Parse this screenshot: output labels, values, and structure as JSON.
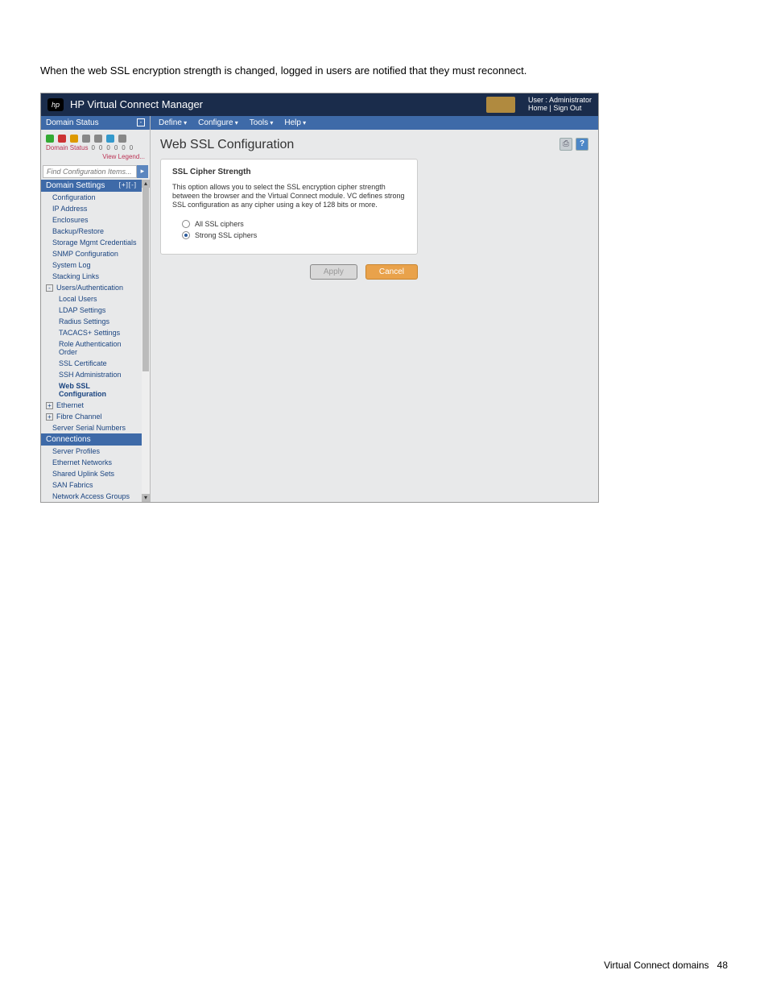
{
  "intro": "When the web SSL encryption strength is changed, logged in users are notified that they must reconnect.",
  "topbar": {
    "title": "HP Virtual Connect Manager",
    "user_label": "User : Administrator",
    "home": "Home",
    "signout": "Sign Out"
  },
  "menus": {
    "define": "Define",
    "configure": "Configure",
    "tools": "Tools",
    "help": "Help"
  },
  "domain_status": {
    "title": "Domain Status",
    "label": "Domain Status",
    "legend": "View Legend...",
    "counts": [
      "0",
      "0",
      "0",
      "0",
      "0",
      "0"
    ]
  },
  "search_placeholder": "Find Configuration Items...",
  "nav": {
    "domain_settings_title": "Domain Settings",
    "items1": [
      "Configuration",
      "IP Address",
      "Enclosures",
      "Backup/Restore",
      "Storage Mgmt Credentials",
      "SNMP Configuration",
      "System Log",
      "Stacking Links"
    ],
    "users_auth": "Users/Authentication",
    "items2": [
      "Local Users",
      "LDAP Settings",
      "Radius Settings",
      "TACACS+ Settings",
      "Role Authentication Order",
      "SSL Certificate",
      "SSH Administration",
      "Web SSL Configuration"
    ],
    "ethernet": "Ethernet",
    "fibre": "Fibre Channel",
    "serial": "Server Serial Numbers",
    "connections_title": "Connections",
    "items3": [
      "Server Profiles",
      "Ethernet Networks",
      "Shared Uplink Sets",
      "SAN Fabrics",
      "Network Access Groups"
    ]
  },
  "main": {
    "page_title": "Web SSL Configuration",
    "card_title": "SSL Cipher Strength",
    "card_text": "This option allows you to select the SSL encryption cipher strength between the browser and the Virtual Connect module. VC defines strong SSL configuration as any cipher using a key of 128 bits or more.",
    "radio_all": "All SSL ciphers",
    "radio_strong": "Strong SSL ciphers",
    "apply": "Apply",
    "cancel": "Cancel"
  },
  "footer": {
    "text": "Virtual Connect domains",
    "page": "48"
  }
}
